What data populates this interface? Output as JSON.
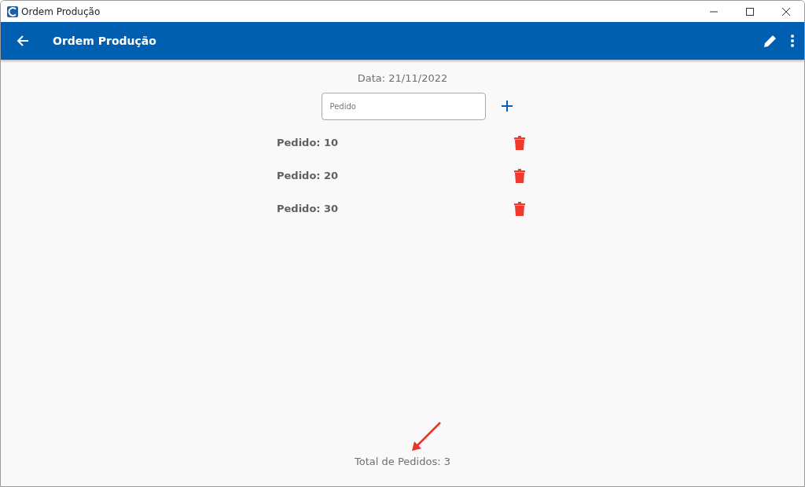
{
  "window": {
    "title": "Ordem Produção"
  },
  "app_bar": {
    "title": "Ordem Produção"
  },
  "date_label": "Data: 21/11/2022",
  "order_field": {
    "placeholder": "Pedido"
  },
  "orders": [
    {
      "label": "Pedido: 10"
    },
    {
      "label": "Pedido: 20"
    },
    {
      "label": "Pedido: 30"
    }
  ],
  "total_label": "Total de Pedidos: 3"
}
